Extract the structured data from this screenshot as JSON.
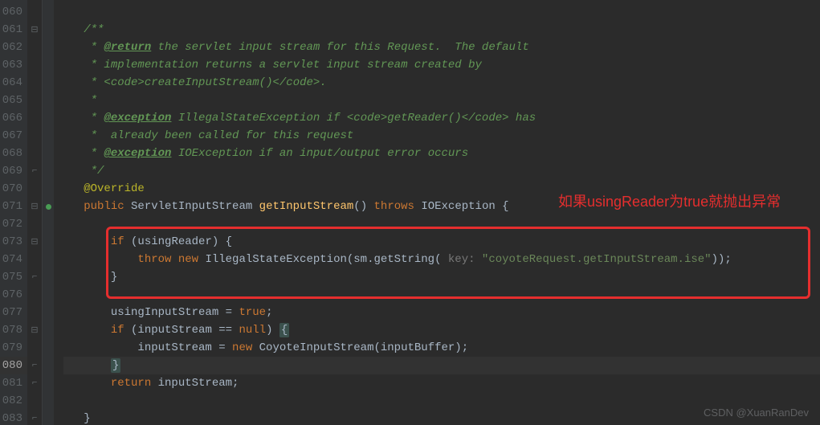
{
  "gutter": {
    "start": 60,
    "end": 83,
    "current_line": 80
  },
  "fold_rows": [
    61,
    71,
    73,
    78
  ],
  "fold_end_rows": [
    69,
    75,
    80,
    81,
    83
  ],
  "marker_rows": [
    71
  ],
  "annotation": {
    "text": "如果usingReader为true就抛出异常"
  },
  "watermark": "CSDN @XuanRanDev",
  "code": {
    "l60": "",
    "l61_a": "/**",
    "l62_a": " * ",
    "l62_tag": "@return",
    "l62_b": " the servlet input stream for this Request.  The default",
    "l63": " * implementation returns a servlet input stream created by",
    "l64_a": " * <code>",
    "l64_m": "createInputStream()",
    "l64_b": "</code>.",
    "l65": " *",
    "l66_a": " * ",
    "l66_tag": "@exception",
    "l66_b": " IllegalStateException if <code>",
    "l66_m": "getReader()",
    "l66_c": "</code> has",
    "l67": " *  already been called for this request",
    "l68_a": " * ",
    "l68_tag": "@exception",
    "l68_b": " IOException if an input/output error occurs",
    "l69": " */",
    "l70": "@Override",
    "l71_kw1": "public ",
    "l71_type": "ServletInputStream ",
    "l71_m": "getInputStream",
    "l71_p": "() ",
    "l71_kw2": "throws ",
    "l71_ex": "IOException {",
    "l72": "",
    "l73_kw": "if ",
    "l73_c": "(usingReader) {",
    "l74_kw1": "throw new ",
    "l74_type": "IllegalStateException(sm.getString(",
    "l74_hint": " key: ",
    "l74_str": "\"coyoteRequest.getInputStream.ise\"",
    "l74_end": "));",
    "l75": "}",
    "l76": "",
    "l77_a": "usingInputStream = ",
    "l77_kw": "true",
    "l77_b": ";",
    "l78_kw": "if ",
    "l78_a": "(inputStream == ",
    "l78_null": "null",
    "l78_b": ") ",
    "l78_brace": "{",
    "l79_a": "inputStream = ",
    "l79_kw": "new ",
    "l79_b": "CoyoteInputStream(inputBuffer);",
    "l80_brace": "}",
    "l81_kw": "return ",
    "l81_b": "inputStream;",
    "l82": "",
    "l83": "}"
  }
}
